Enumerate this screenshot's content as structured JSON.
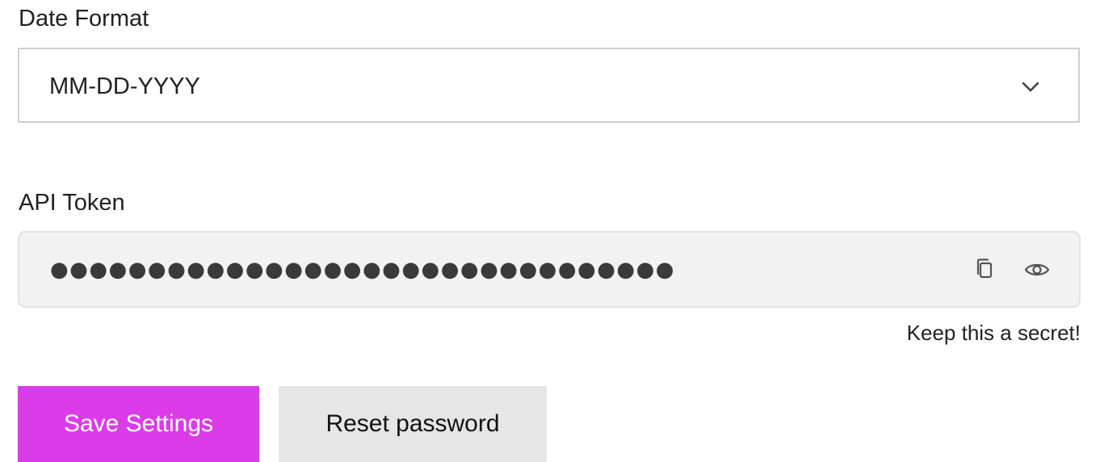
{
  "date_format": {
    "label": "Date Format",
    "selected": "MM-DD-YYYY"
  },
  "api_token": {
    "label": "API Token",
    "masked_value": "●●●●●●●●●●●●●●●●●●●●●●●●●●●●●●●●",
    "hint": "Keep this a secret!"
  },
  "actions": {
    "save_label": "Save Settings",
    "reset_label": "Reset password"
  },
  "icons": {
    "select_arrow": "chevron-down-icon",
    "copy": "copy-icon",
    "reveal": "eye-icon"
  },
  "colors": {
    "primary": "#dc3be9",
    "secondary": "#e6e6e6",
    "token_background": "#f1f2f1"
  }
}
